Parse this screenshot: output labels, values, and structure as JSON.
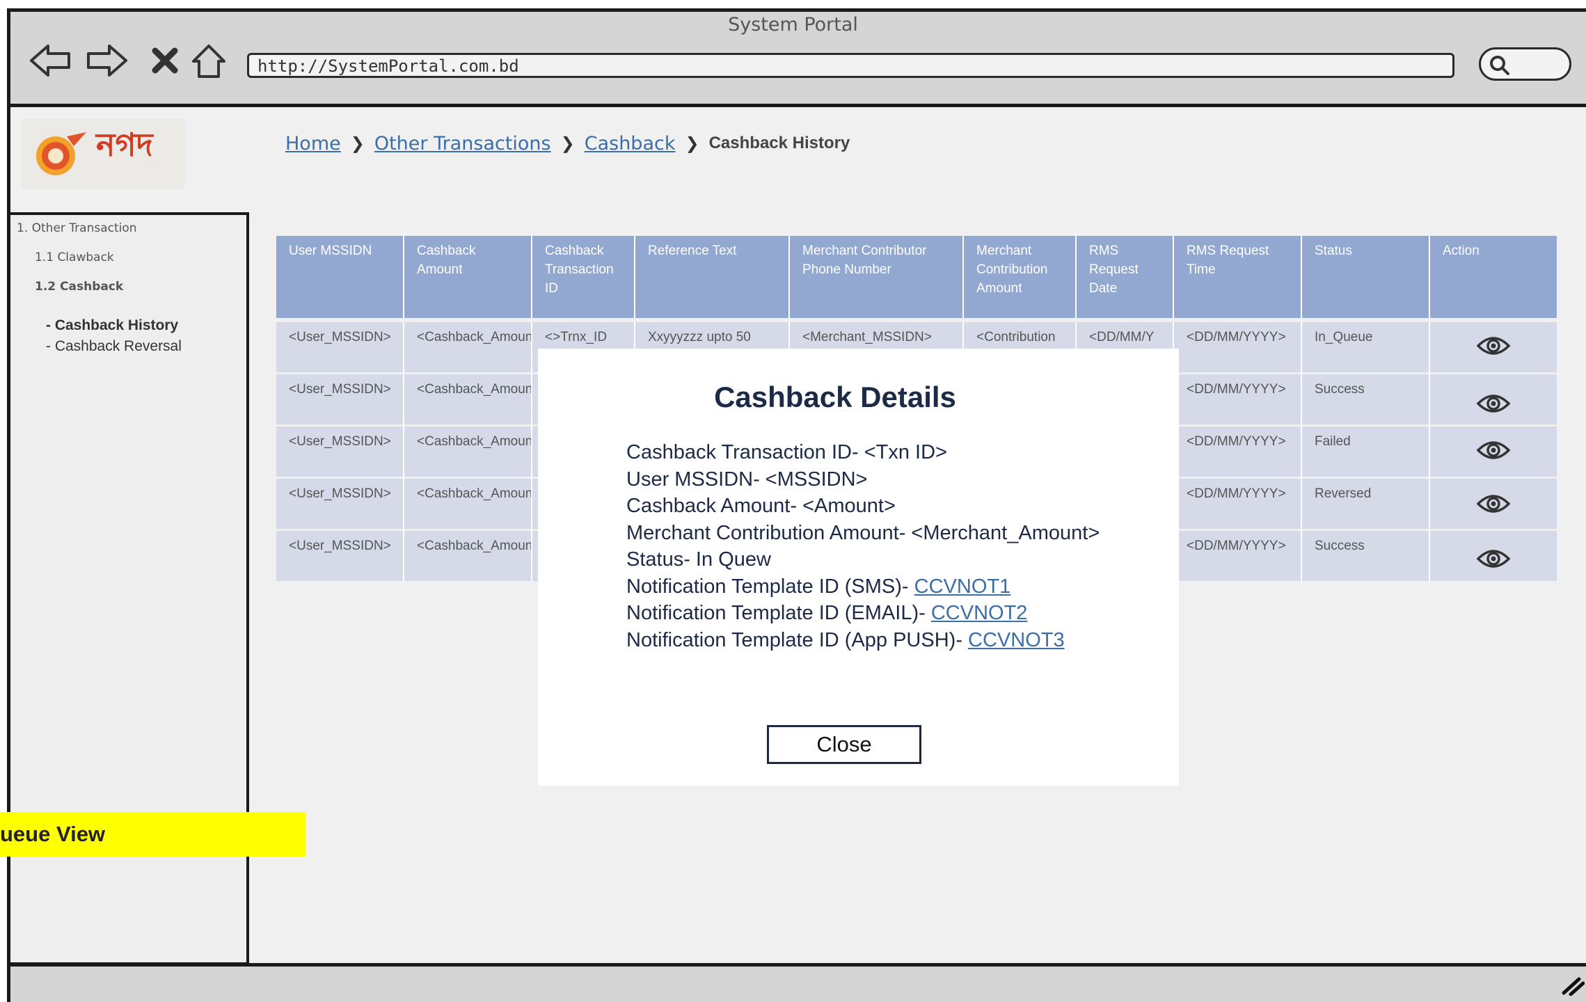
{
  "browser": {
    "title": "System Portal",
    "url": "http://SystemPortal.com.bd"
  },
  "logo": {
    "text": "নগদ"
  },
  "breadcrumb": {
    "home": "Home",
    "other_transactions": "Other Transactions",
    "cashback": "Cashback",
    "current": "Cashback History"
  },
  "sidebar": {
    "section": "1. Other Transaction",
    "items": [
      {
        "label": "1.1 Clawback"
      },
      {
        "label": "1.2 Cashback"
      }
    ],
    "subitems": [
      {
        "label": "- Cashback History"
      },
      {
        "label": "- Cashback Reversal"
      }
    ]
  },
  "table": {
    "headers": [
      "User MSSIDN",
      "Cashback Amount",
      "Cashback Transaction ID",
      "Reference Text",
      "Merchant Contributor Phone Number",
      "Merchant Contribution Amount",
      "RMS Request Date",
      "RMS Request Time",
      "Status",
      "Action"
    ],
    "rows": [
      [
        "<User_MSSIDN>",
        "<Cashback_Amount>",
        "<>Trnx_ID",
        "Xxyyyzzz upto 50",
        "<Merchant_MSSIDN>",
        "<Contribution",
        "<DD/MM/Y",
        "<DD/MM/YYYY>",
        "In_Queue"
      ],
      [
        "<User_MSSIDN>",
        "<Cashback_Amount>",
        "",
        "",
        "",
        "",
        "",
        "<DD/MM/YYYY>",
        "Success"
      ],
      [
        "<User_MSSIDN>",
        "<Cashback_Amount>",
        "",
        "",
        "",
        "",
        "",
        "<DD/MM/YYYY>",
        "Failed"
      ],
      [
        "<User_MSSIDN>",
        "<Cashback_Amount>",
        "",
        "",
        "",
        "",
        "",
        "<DD/MM/YYYY>",
        "Reversed"
      ],
      [
        "<User_MSSIDN>",
        "<Cashback_Amount>",
        "",
        "",
        "",
        "",
        "",
        "<DD/MM/YYYY>",
        "Success"
      ]
    ],
    "action_icon": "eye-icon"
  },
  "highlight": {
    "text": "ueue View"
  },
  "modal": {
    "title": "Cashback Details",
    "lines": [
      {
        "text": "Cashback Transaction ID- <Txn ID>",
        "link": ""
      },
      {
        "text": "User MSSIDN- <MSSIDN>",
        "link": ""
      },
      {
        "text": "Cashback Amount- <Amount>",
        "link": ""
      },
      {
        "text": "Merchant Contribution Amount- <Merchant_Amount>",
        "link": ""
      },
      {
        "text": "Status- In Quew",
        "link": ""
      },
      {
        "text": "Notification Template ID (SMS)- ",
        "link": "CCVNOT1"
      },
      {
        "text": "Notification Template ID (EMAIL)- ",
        "link": "CCVNOT2"
      },
      {
        "text": "Notification Template ID (App PUSH)- ",
        "link": "CCVNOT3"
      }
    ],
    "close_label": "Close"
  },
  "colors": {
    "table_header": "#93a8d1",
    "table_row": "#d6dae8",
    "link": "#3b6ea8",
    "highlight": "#ffff00",
    "modal_text": "#1c2a47"
  }
}
